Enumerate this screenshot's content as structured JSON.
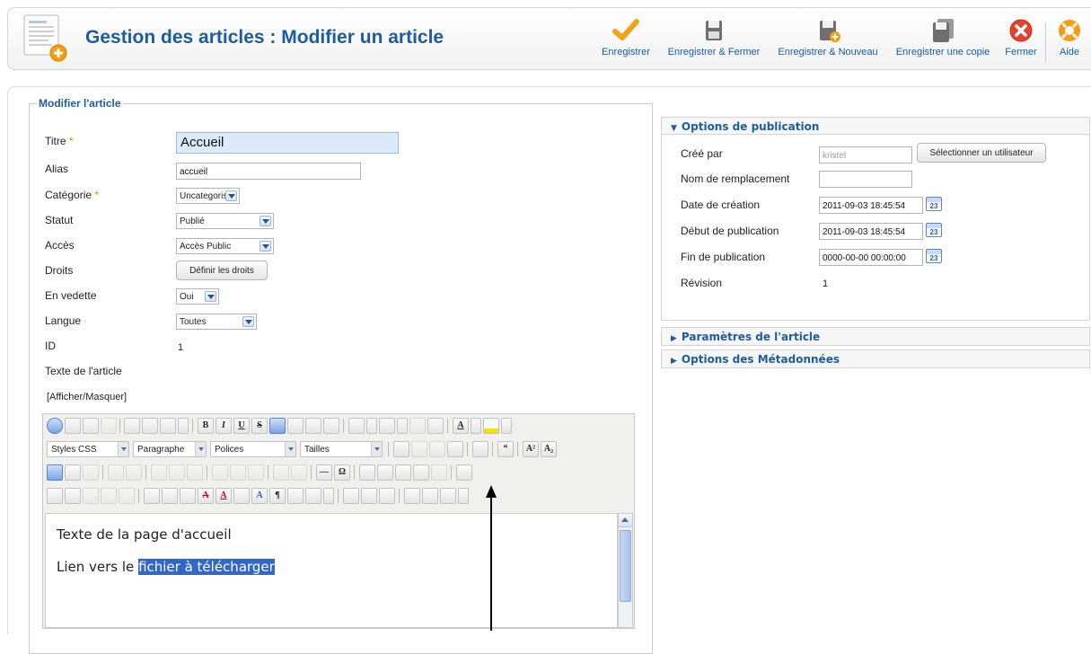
{
  "header": {
    "title": "Gestion des articles : Modifier un article",
    "toolbar": [
      {
        "label": "Enregistrer",
        "icon": "checkmark-icon"
      },
      {
        "label": "Enregistrer & Fermer",
        "icon": "save-icon"
      },
      {
        "label": "Enregistrer & Nouveau",
        "icon": "save-new-icon"
      },
      {
        "label": "Enregistrer une copie",
        "icon": "save-copy-icon"
      },
      {
        "label": "Fermer",
        "icon": "close-icon"
      },
      {
        "label": "Aide",
        "icon": "help-icon"
      }
    ]
  },
  "form": {
    "legend": "Modifier l'article",
    "fields": {
      "titre": {
        "label": "Titre",
        "value": "Accueil",
        "required_mark": "*"
      },
      "alias": {
        "label": "Alias",
        "value": "accueil"
      },
      "categorie": {
        "label": "Catégorie",
        "value": "Uncategorised",
        "required_mark": "*"
      },
      "statut": {
        "label": "Statut",
        "value": "Publié"
      },
      "acces": {
        "label": "Accès",
        "value": "Accès Public"
      },
      "droits": {
        "label": "Droits",
        "button": "Définir les droits"
      },
      "vedette": {
        "label": "En vedette",
        "value": "Oui"
      },
      "langue": {
        "label": "Langue",
        "value": "Toutes"
      },
      "id": {
        "label": "ID",
        "value": "1"
      },
      "texte": {
        "label": "Texte de l'article"
      }
    },
    "toggle_editor": "[Afficher/Masquer]"
  },
  "editor": {
    "combos": [
      "Styles CSS",
      "Paragraphe",
      "Polices",
      "Tailles"
    ],
    "content_line1": "Texte de la page d'accueil",
    "content_line2_prefix": "Lien vers le ",
    "content_link": "fichier à télécharger"
  },
  "publishing": {
    "title": "Options de publication",
    "created_by_label": "Créé par",
    "created_by_value": "kristel",
    "select_user_button": "Sélectionner un utilisateur",
    "alias_label": "Nom de remplacement",
    "alias_value": "",
    "created_label": "Date de création",
    "created_value": "2011-09-03 18:45:54",
    "publish_up_label": "Début de publication",
    "publish_up_value": "2011-09-03 18:45:54",
    "publish_down_label": "Fin de publication",
    "publish_down_value": "0000-00-00 00:00:00",
    "revision_label": "Révision",
    "revision_value": "1",
    "calendar_glyph": "23"
  },
  "panels": {
    "article_params": "Paramètres de l'article",
    "metadata": "Options des Métadonnées"
  }
}
